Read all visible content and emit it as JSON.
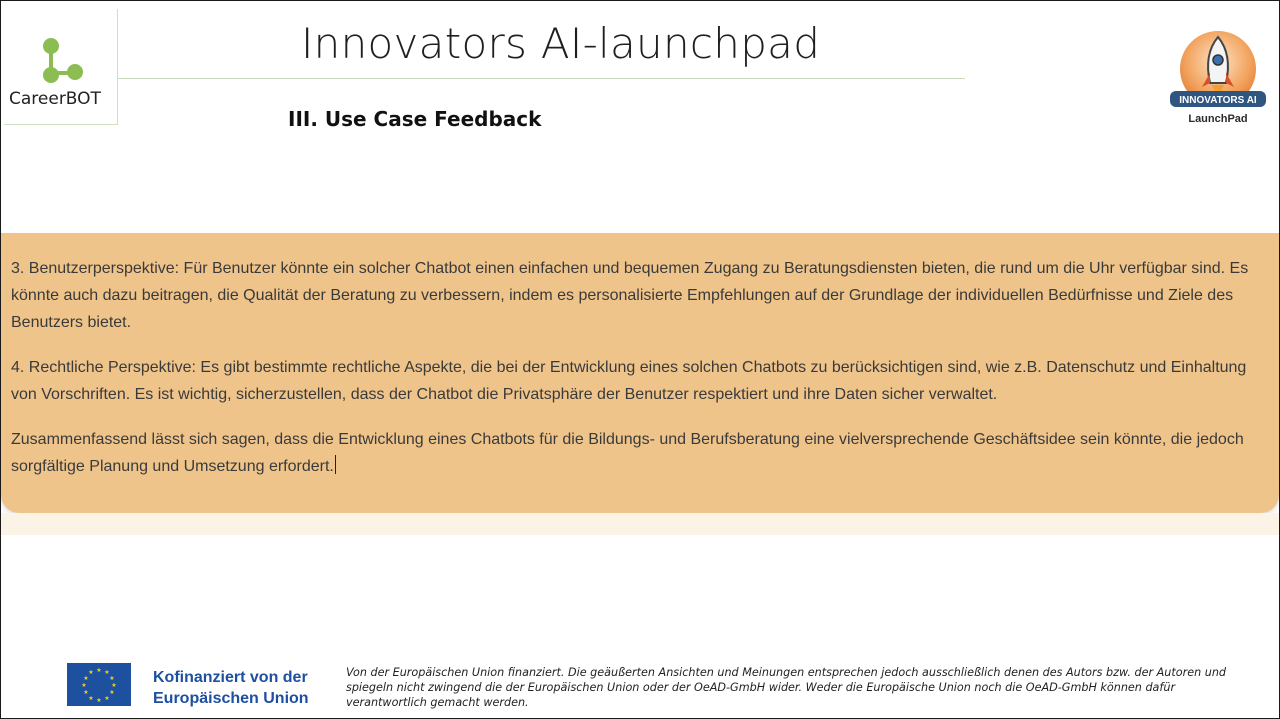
{
  "header": {
    "logo_label": "CareerBOT",
    "title": "Innovators AI-launchpad",
    "subtitle": "III. Use Case Feedback",
    "badge_top": "INNOVATORS AI",
    "badge_bottom": "LaunchPad"
  },
  "panel": {
    "paragraphs": [
      "3. Benutzerperspektive: Für Benutzer könnte ein solcher Chatbot einen einfachen und bequemen Zugang zu Beratungsdiensten bieten, die rund um die Uhr verfügbar sind. Es könnte auch dazu beitragen, die Qualität der Beratung zu verbessern, indem es personalisierte Empfehlungen auf der Grundlage der individuellen Bedürfnisse und Ziele des Benutzers bietet.",
      "4. Rechtliche Perspektive: Es gibt bestimmte rechtliche Aspekte, die bei der Entwicklung eines solchen Chatbots zu berücksichtigen sind, wie z.B. Datenschutz und Einhaltung von Vorschriften. Es ist wichtig, sicherzustellen, dass der Chatbot die Privatsphäre der Benutzer respektiert und ihre Daten sicher verwaltet.",
      "Zusammenfassend lässt sich sagen, dass die Entwicklung eines Chatbots für die Bildungs- und Berufsberatung eine vielversprechende Geschäftsidee sein könnte, die jedoch sorgfältige Planung und Umsetzung erfordert."
    ]
  },
  "footer": {
    "eu_line1": "Kofinanziert von der",
    "eu_line2": "Europäischen Union",
    "disclaimer": "Von der Europäischen Union finanziert. Die geäußerten Ansichten und Meinungen entsprechen jedoch ausschließlich denen des Autors bzw. der Autoren und spiegeln nicht zwingend die der Europäischen Union oder der OeAD-GmbH wider. Weder die Europäische Union noch die OeAD-GmbH können dafür verantwortlich gemacht werden."
  },
  "colors": {
    "panel": "#efc48b",
    "logo_green": "#8cbd52",
    "eu_blue": "#1e50a0",
    "eu_star": "#f7d117"
  },
  "icons": [
    "careerbot-logo-icon",
    "rocket-badge-icon",
    "eu-flag-icon"
  ]
}
